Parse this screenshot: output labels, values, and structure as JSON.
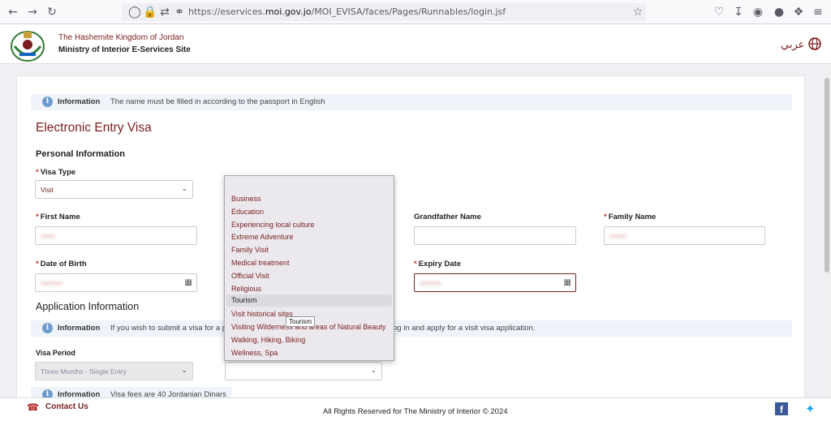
{
  "browser": {
    "url_prefix": "https://eservices.",
    "url_domain": "moi.gov.jo",
    "url_path": "/MOI_EVISA/faces/Pages/Runnables/login.jsf"
  },
  "header": {
    "kingdom": "The Hashemite Kingdom of Jordan",
    "ministry": "Ministry of Interior E-Services Site",
    "lang_toggle": "عربي"
  },
  "info_top": {
    "label": "Information",
    "text": "The name must be filled in according to the passport in English"
  },
  "page_title": "Electronic Entry Visa",
  "personal": {
    "heading": "Personal Information",
    "visa_type_label": "Visa Type",
    "visa_type_value": "Visit",
    "first_name_label": "First Name",
    "first_name_value": "••••••",
    "grandfather_label": "Grandfather Name",
    "family_name_label": "Family Name",
    "family_name_value": "•••••••",
    "dob_label": "Date of Birth",
    "dob_value": "•••••••••",
    "expiry_label": "Expiry Date",
    "expiry_value": "•••••••••"
  },
  "application": {
    "heading": "Application Information",
    "info_label": "Information",
    "info_text_left": "If you wish to submit a visa for a p",
    "info_text_right": "og in and apply for a visit visa application.",
    "visa_period_label": "Visa Period",
    "visa_period_value": "Three Months - Single Entry",
    "fees_label": "Information",
    "fees_text": "Visa fees are 40 Jordanian Dinars"
  },
  "dropdown": {
    "items": [
      "Business",
      "Education",
      "Experiencing local culture",
      "Extreme Adventure",
      "Family Visit",
      "Medical treatment",
      "Official Visit",
      "Religious",
      "Tourism",
      "Visit historical sites",
      "Visiting Wilderness and areas of Natural Beauty",
      "Walking, Hiking, Biking",
      "Wellness, Spa"
    ],
    "highlighted_index": 8,
    "tooltip": "Tourism"
  },
  "footer": {
    "contact": "Contact Us",
    "rights": "All Rights Reserved for The Ministry of Interior © 2024"
  }
}
